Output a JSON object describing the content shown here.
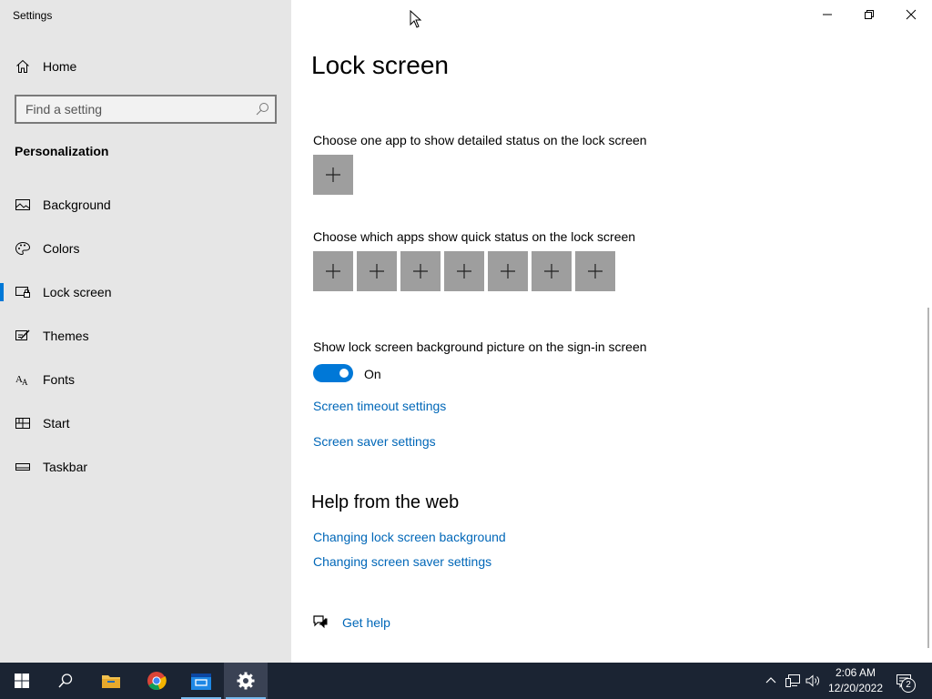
{
  "window": {
    "title": "Settings"
  },
  "sidebar": {
    "home_label": "Home",
    "search_placeholder": "Find a setting",
    "section": "Personalization",
    "items": [
      {
        "label": "Background",
        "icon": "picture-icon"
      },
      {
        "label": "Colors",
        "icon": "palette-icon"
      },
      {
        "label": "Lock screen",
        "icon": "lock-screen-icon",
        "active": true
      },
      {
        "label": "Themes",
        "icon": "themes-icon"
      },
      {
        "label": "Fonts",
        "icon": "fonts-icon"
      },
      {
        "label": "Start",
        "icon": "start-icon"
      },
      {
        "label": "Taskbar",
        "icon": "taskbar-icon"
      }
    ]
  },
  "main": {
    "title": "Lock screen",
    "detailed_status_label": "Choose one app to show detailed status on the lock screen",
    "quick_status_label": "Choose which apps show quick status on the lock screen",
    "quick_status_count": 7,
    "background_label": "Show lock screen background picture on the sign-in screen",
    "toggle_state": "On",
    "timeout_link": "Screen timeout settings",
    "saver_link": "Screen saver settings",
    "help_heading": "Help from the web",
    "help_links": [
      "Changing lock screen background",
      "Changing screen saver settings"
    ],
    "get_help": "Get help"
  },
  "taskbar": {
    "apps": [
      "start-icon",
      "search-icon",
      "file-explorer-icon",
      "chrome-icon",
      "store-app-icon",
      "settings-icon"
    ],
    "active_app": "settings-icon",
    "time": "2:06 AM",
    "date": "12/20/2022",
    "notification_count": "2"
  },
  "colors": {
    "accent": "#0078d7",
    "link": "#0067b8",
    "sidebar_bg": "#e6e6e6",
    "tile_bg": "#9e9e9e",
    "taskbar_bg": "#1b2433"
  }
}
